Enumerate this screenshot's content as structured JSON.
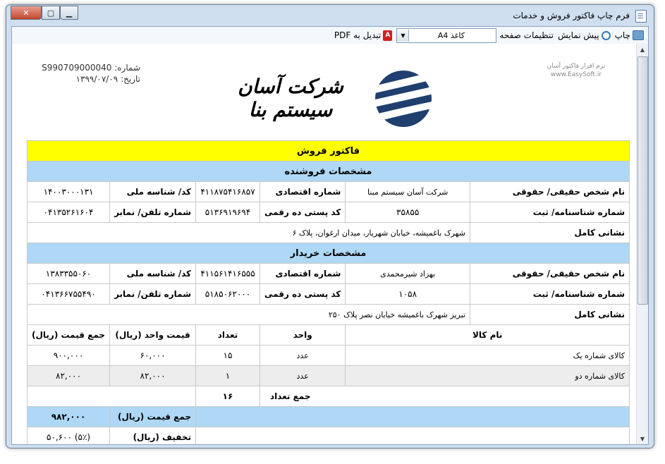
{
  "window": {
    "title": "فرم چاپ فاکتور فروش و خدمات"
  },
  "toolbar": {
    "print": "چاپ",
    "preview": "پیش نمایش",
    "page_settings": "تنظیمات صفحه",
    "paper_value": "کاغذ A4",
    "to_pdf": "تبدیل به PDF"
  },
  "header": {
    "company_note_line1": "نرم افزار فاکتور آسان",
    "company_note_line2": "www.EasySoft.ir",
    "number_label": "شماره:",
    "number_value": "S990709000040",
    "date_label": "تاریخ:",
    "date_value": "۱۳۹۹/۰۷/۰۹",
    "logo_text": "شرکت آسان سیستم بنا"
  },
  "invoice": {
    "title": "فاکتور فروش",
    "seller_title": "مشخصات فروشنده",
    "buyer_title": "مشخصات خریدار",
    "labels": {
      "name": "نام شخص حقیقی/ حقوقی",
      "economic": "شماره اقتصادی",
      "national": "کد/ شناسه ملی",
      "reg": "شماره شناسنامه/ ثبت",
      "postal": "کد پستی ده رقمی",
      "phone": "شماره تلفن/ نمابر",
      "address": "نشانی کامل"
    },
    "seller": {
      "name": "شرکت آسان سیستم مبنا",
      "economic": "۴۱۱۸۷۵۴۱۶۸۵۷",
      "national": "۱۴۰۰۳۰۰۰۱۳۱",
      "reg": "۳۵۸۵۵",
      "postal": "۵۱۳۶۹۱۹۶۹۴",
      "phone": "۰۴۱۳۵۲۶۱۶۰۴",
      "address": "شهرک باغمیشه، خیابان شهریار، میدان ارغوان، پلاک ۶"
    },
    "buyer": {
      "name": "بهزاد شیرمحمدی",
      "economic": "۴۱۱۵۶۱۴۱۶۵۵۵",
      "national": "۱۳۸۳۳۵۵۰۶۰",
      "reg": "۱۰۵۸",
      "postal": "۵۱۸۵۰۶۲۰۰۰",
      "phone": "۰۴۱۳۶۶۷۵۵۴۹۰",
      "address": "تبریز شهرک باغمیشه خیابان نصر پلاک ۲۵۰"
    },
    "cols": {
      "item": "نام کالا",
      "unit": "واحد",
      "qty": "تعداد",
      "unit_price": "قیمت واحد (ریال)",
      "total": "جمع قیمت (ریال)"
    },
    "items": [
      {
        "name": "کالای شماره یک",
        "unit": "عدد",
        "qty": "۱۵",
        "unit_price": "۶۰,۰۰۰",
        "total": "۹۰۰,۰۰۰"
      },
      {
        "name": "کالای شماره دو",
        "unit": "عدد",
        "qty": "۱",
        "unit_price": "۸۲,۰۰۰",
        "total": "۸۲,۰۰۰"
      }
    ],
    "sum_qty_label": "جمع تعداد",
    "sum_qty_value": "۱۶",
    "sum_price_label": "جمع قیمت (ریال)",
    "sum_price_value": "۹۸۲,۰۰۰",
    "discount_label": "تخفیف (ریال)",
    "discount_value": "(۵٪) ۵۰,۶۰۰"
  }
}
